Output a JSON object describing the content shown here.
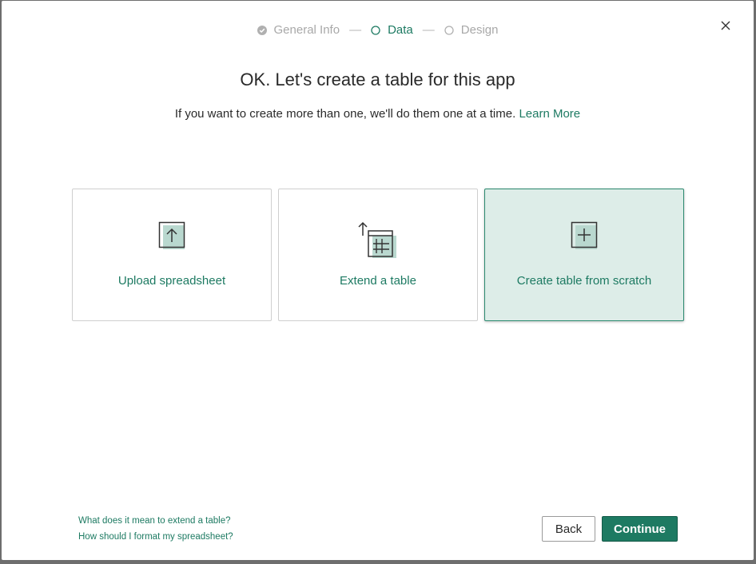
{
  "stepper": {
    "steps": [
      {
        "label": "General Info",
        "state": "done"
      },
      {
        "label": "Data",
        "state": "active"
      },
      {
        "label": "Design",
        "state": "todo"
      }
    ],
    "separator": "—"
  },
  "dialog": {
    "title": "OK. Let's create a table for this app",
    "subtitle": "If you want to create more than one, we'll do them one at a time.",
    "learn_more": "Learn More",
    "close_icon": "close-icon"
  },
  "options": [
    {
      "label": "Upload spreadsheet",
      "icon": "upload-icon",
      "selected": false
    },
    {
      "label": "Extend a table",
      "icon": "extend-table-icon",
      "selected": false
    },
    {
      "label": "Create table from scratch",
      "icon": "add-table-icon",
      "selected": true
    }
  ],
  "help_links": [
    "What does it mean to extend a table?",
    "How should I format my spreadsheet?"
  ],
  "buttons": {
    "back": "Back",
    "continue": "Continue"
  },
  "colors": {
    "accent": "#1d7a62",
    "selected_bg": "#ddede8",
    "muted": "#a8a8a8"
  }
}
